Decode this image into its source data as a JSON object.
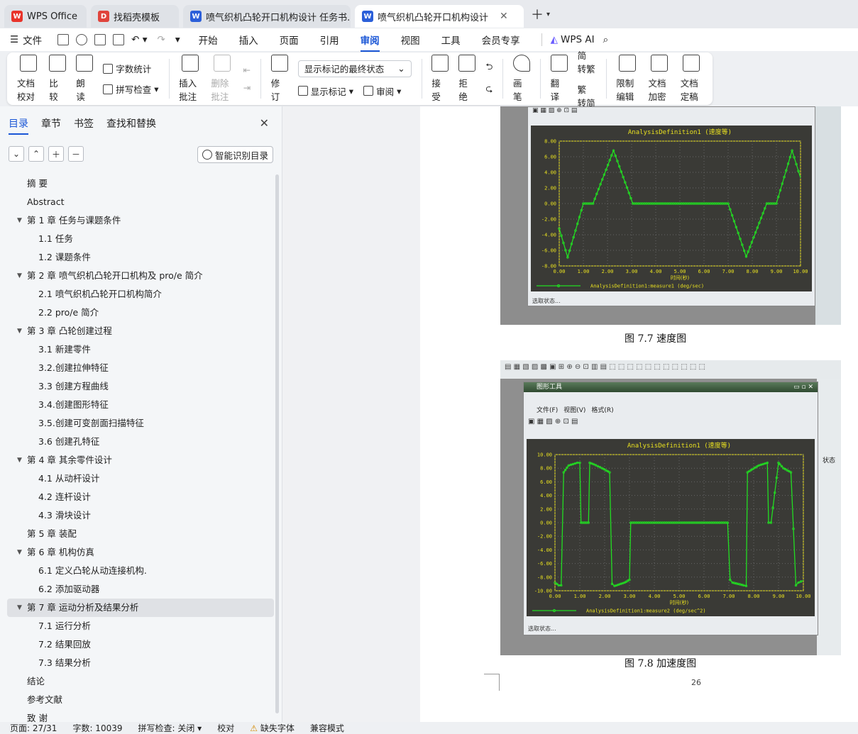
{
  "tabs": [
    {
      "label": "WPS Office",
      "icon": "wps-logo-icon"
    },
    {
      "label": "找稻壳模板",
      "icon": "docer-icon"
    },
    {
      "label": "喷气织机凸轮开口机构设计 任务书.dc",
      "icon": "writer-doc-icon"
    },
    {
      "label": "喷气织机凸轮开口机构设计 毕",
      "icon": "writer-doc-icon"
    }
  ],
  "menu": {
    "file": "文件",
    "items": [
      "开始",
      "插入",
      "页面",
      "引用",
      "审阅",
      "视图",
      "工具",
      "会员专享"
    ],
    "active": "审阅",
    "ai": "WPS AI"
  },
  "ribbon": {
    "doc_check": "文档校对",
    "compare": "比较",
    "read_aloud": "朗读",
    "word_count": "字数统计",
    "spell_check": "拼写检查",
    "insert_comment": "插入批注",
    "delete_comment": "删除批注",
    "revise": "修订",
    "markup_state": "显示标记的最终状态",
    "show_markup": "显示标记",
    "review": "审阅",
    "accept": "接受",
    "reject": "拒绝",
    "pen": "画笔",
    "translate": "翻译",
    "to_traditional": "简 转繁",
    "to_simplified": "繁 转简",
    "restrict_edit": "限制编辑",
    "encrypt": "文档加密",
    "finalize": "文档定稿"
  },
  "panel": {
    "tabs": [
      "目录",
      "章节",
      "书签",
      "查找和替换"
    ],
    "smart_toc": "智能识别目录",
    "toc": [
      {
        "text": "摘  要",
        "level": 1,
        "expand": false
      },
      {
        "text": "Abstract",
        "level": 1,
        "expand": false
      },
      {
        "text": "第 1 章  任务与课题条件",
        "level": 1,
        "expand": true
      },
      {
        "text": "1.1  任务",
        "level": 2,
        "expand": false
      },
      {
        "text": "1.2  课题条件",
        "level": 2,
        "expand": false
      },
      {
        "text": "第 2 章  喷气织机凸轮开口机构及 pro/e 简介",
        "level": 1,
        "expand": true
      },
      {
        "text": "2.1  喷气织机凸轮开口机构简介",
        "level": 2,
        "expand": false
      },
      {
        "text": "2.2 pro/e 简介",
        "level": 2,
        "expand": false
      },
      {
        "text": "第 3 章  凸轮创建过程",
        "level": 1,
        "expand": true
      },
      {
        "text": "3.1  新建零件",
        "level": 2,
        "expand": false
      },
      {
        "text": "3.2.创建拉伸特征",
        "level": 2,
        "expand": false
      },
      {
        "text": "3.3  创建方程曲线",
        "level": 2,
        "expand": false
      },
      {
        "text": "3.4.创建图形特征",
        "level": 2,
        "expand": false
      },
      {
        "text": "3.5.创建可变剖面扫描特征",
        "level": 2,
        "expand": false
      },
      {
        "text": "3.6 创建孔特征",
        "level": 2,
        "expand": false
      },
      {
        "text": "第 4 章    其余零件设计",
        "level": 1,
        "expand": true
      },
      {
        "text": "4.1 从动杆设计",
        "level": 2,
        "expand": false
      },
      {
        "text": "4.2 连杆设计",
        "level": 2,
        "expand": false
      },
      {
        "text": "4.3 滑块设计",
        "level": 2,
        "expand": false
      },
      {
        "text": "第 5 章  装配",
        "level": 1,
        "expand": false
      },
      {
        "text": "第 6 章  机构仿真",
        "level": 1,
        "expand": true
      },
      {
        "text": "6.1  定义凸轮从动连接机构.",
        "level": 2,
        "expand": false
      },
      {
        "text": "6.2  添加驱动器",
        "level": 2,
        "expand": false
      },
      {
        "text": "第 7 章    运动分析及结果分析",
        "level": 1,
        "expand": true,
        "selected": true
      },
      {
        "text": "7.1  运行分析",
        "level": 2,
        "expand": false
      },
      {
        "text": "7.2    结果回放",
        "level": 2,
        "expand": false
      },
      {
        "text": "7.3    结果分析",
        "level": 2,
        "expand": false
      },
      {
        "text": "结论",
        "level": 1,
        "expand": false
      },
      {
        "text": "参考文献",
        "level": 1,
        "expand": false
      },
      {
        "text": "致  谢",
        "level": 1,
        "expand": false
      }
    ]
  },
  "doc": {
    "fig1": {
      "title": "AnalysisDefinition1 (速度等)",
      "legend": "AnalysisDefinition1:measure1 (deg/sec)",
      "xlabel": "时间(秒)",
      "status": "选取状态...",
      "caption": "图 7.7  速度图"
    },
    "fig2": {
      "window_title": "图形工具",
      "menu": [
        "文件(F)",
        "视图(V)",
        "格式(R)"
      ],
      "title": "AnalysisDefinition1 (速度等)",
      "legend": "AnalysisDefinition1:measure2 (deg/sec^2)",
      "xlabel": "时间(秒)",
      "status": "选取状态...",
      "caption": "图 7.8  加速度图",
      "side_label": "状态"
    },
    "page_number": "26"
  },
  "chart_data": [
    {
      "type": "line",
      "title": "AnalysisDefinition1 (速度等)",
      "xlabel": "时间(秒)",
      "ylabel": "",
      "xlim": [
        0,
        10
      ],
      "ylim": [
        -8,
        8
      ],
      "xticks": [
        0,
        1,
        2,
        3,
        4,
        5,
        6,
        7,
        8,
        9,
        10
      ],
      "yticks": [
        -8,
        -6,
        -4,
        -2,
        0,
        2,
        4,
        6,
        8
      ],
      "series": [
        {
          "name": "AnalysisDefinition1:measure1 (deg/sec)",
          "x": [
            0,
            0.35,
            1.0,
            1.4,
            2.25,
            3.05,
            7.0,
            7.75,
            8.6,
            9.0,
            9.65,
            10.0
          ],
          "y": [
            -3.2,
            -6.9,
            0,
            0,
            6.8,
            0,
            0,
            -6.8,
            0,
            0,
            6.8,
            3.3
          ]
        }
      ],
      "grid": true,
      "color": "#22dd22"
    },
    {
      "type": "line",
      "title": "AnalysisDefinition1 (速度等)",
      "xlabel": "时间(秒)",
      "ylabel": "",
      "xlim": [
        0,
        10
      ],
      "ylim": [
        -10,
        10
      ],
      "xticks": [
        0,
        1,
        2,
        3,
        4,
        5,
        6,
        7,
        8,
        9,
        10
      ],
      "yticks": [
        -10,
        -8,
        -6,
        -4,
        -2,
        0,
        2,
        4,
        6,
        8,
        10
      ],
      "series": [
        {
          "name": "AnalysisDefinition1:measure2 (deg/sec^2)",
          "x": [
            0,
            0.15,
            0.25,
            0.35,
            0.55,
            0.9,
            1.0,
            1.05,
            1.35,
            1.4,
            1.55,
            1.9,
            2.2,
            2.3,
            2.4,
            2.8,
            3.0,
            3.05,
            6.95,
            7.05,
            7.15,
            7.6,
            7.7,
            7.75,
            8.2,
            8.55,
            8.6,
            8.7,
            9.0,
            9.05,
            9.2,
            9.5,
            9.7,
            9.8,
            10.0
          ],
          "y": [
            -8.8,
            -9.2,
            -9.2,
            7.4,
            8.4,
            8.8,
            8.8,
            0,
            0,
            8.8,
            8.6,
            8.0,
            7.4,
            -9.0,
            -9.3,
            -8.8,
            -8.4,
            0,
            0,
            -8.4,
            -8.8,
            -9.2,
            -9.3,
            7.4,
            8.4,
            8.8,
            0,
            0,
            8.8,
            8.6,
            8.0,
            7.4,
            -9.2,
            -8.8,
            -8.5
          ]
        }
      ],
      "grid": true,
      "color": "#22dd22"
    }
  ],
  "status": {
    "page": "页面: 27/31",
    "words": "字数: 10039",
    "spell": "拼写检查: 关闭",
    "proof": "校对",
    "missing_font": "缺失字体",
    "compat": "兼容模式"
  },
  "colors": {
    "accent": "#1a56d6",
    "plot_bg": "#3a3a36",
    "plot_line": "#22dd22",
    "plot_axis": "#e8e020"
  }
}
